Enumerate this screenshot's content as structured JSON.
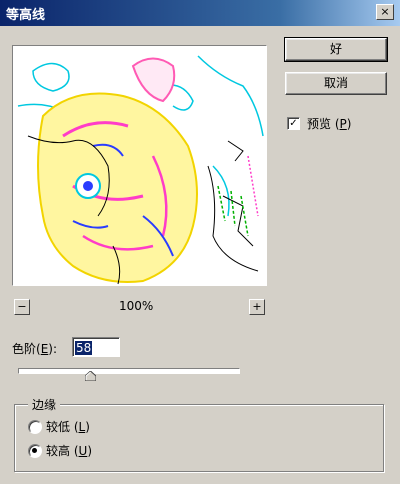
{
  "window": {
    "title": "等高线",
    "close_label": "×"
  },
  "buttons": {
    "ok": "好",
    "cancel": "取消"
  },
  "preview_toggle": {
    "label": "预览",
    "mnemonic": "P",
    "checked": true
  },
  "zoom": {
    "minus": "−",
    "plus": "+",
    "level": "100%"
  },
  "level": {
    "label": "色阶",
    "mnemonic": "E",
    "value": "58",
    "slider_fraction": 0.325
  },
  "edge": {
    "title": "边缘",
    "options": [
      {
        "label": "较低",
        "mnemonic": "L",
        "selected": false
      },
      {
        "label": "较高",
        "mnemonic": "U",
        "selected": true
      }
    ]
  }
}
